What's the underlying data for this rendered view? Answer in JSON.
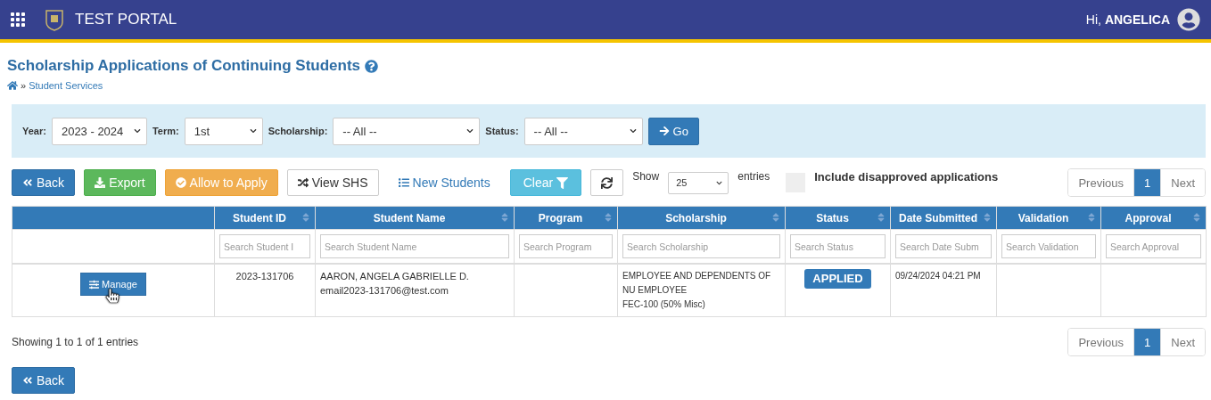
{
  "header": {
    "title": "TEST PORTAL",
    "greeting": "Hi,",
    "user": "ANGELICA"
  },
  "page": {
    "title": "Scholarship Applications of Continuing Students",
    "breadcrumb": [
      {
        "label": "»",
        "kind": "sep"
      },
      {
        "label": "Student Services",
        "kind": "link"
      }
    ]
  },
  "filters": [
    {
      "label": "Year:",
      "value": "2023 - 2024"
    },
    {
      "label": "Term:",
      "value": "1st"
    },
    {
      "label": "Scholarship:",
      "value": "-- All --"
    },
    {
      "label": "Status:",
      "value": "-- All --"
    }
  ],
  "go_button": "Go",
  "toolbar": [
    {
      "kind": "back",
      "label": "Back"
    },
    {
      "kind": "export",
      "label": "Export"
    },
    {
      "kind": "allow",
      "label": "Allow to Apply"
    },
    {
      "kind": "shs",
      "label": "View SHS"
    },
    {
      "kind": "list",
      "label": "New Students"
    },
    {
      "kind": "clear",
      "label": "Clear"
    },
    {
      "kind": "refresh"
    }
  ],
  "length": {
    "show": "Show",
    "value": "25",
    "entries": "entries"
  },
  "include_disapproved": {
    "label": "Include disapproved applications",
    "checked": false
  },
  "pagination_top": [
    {
      "label": "Previous",
      "selected": false
    },
    {
      "label": "1",
      "selected": true
    },
    {
      "label": "Next",
      "selected": false
    }
  ],
  "table": {
    "columns": [
      {
        "sortable": false
      },
      {
        "label": "Student ID",
        "sortable": true,
        "placeholder": "Search Student I"
      },
      {
        "label": "Student Name",
        "sortable": true,
        "placeholder": "Search Student Name"
      },
      {
        "label": "Program",
        "sortable": true,
        "placeholder": "Search Program"
      },
      {
        "label": "Scholarship",
        "sortable": true,
        "placeholder": "Search Scholarship"
      },
      {
        "label": "Status",
        "sortable": true,
        "placeholder": "Search Status"
      },
      {
        "label": "Date Submitted",
        "sortable": true,
        "placeholder": "Search Date Subm"
      },
      {
        "label": "Validation",
        "sortable": true,
        "placeholder": "Search Validation"
      },
      {
        "label": "Approval",
        "sortable": true,
        "placeholder": "Search Approval"
      }
    ],
    "rows": [
      {
        "action": "Manage",
        "student_id": "2023-131706",
        "name": "AARON, ANGELA GABRIELLE D.",
        "email": "email2023-131706@test.com",
        "scholarship": [
          "EMPLOYEE AND DEPENDENTS OF NU EMPLOYEE",
          "FEC-100 (50% Misc)"
        ],
        "status": "APPLIED",
        "date_submitted": "09/24/2024 04:21 PM"
      }
    ]
  },
  "info": "Showing 1 to 1 of 1 entries",
  "pagination_bottom": [
    {
      "label": "Previous",
      "selected": false
    },
    {
      "label": "1",
      "selected": true
    },
    {
      "label": "Next",
      "selected": false
    }
  ],
  "back_button": "Back"
}
